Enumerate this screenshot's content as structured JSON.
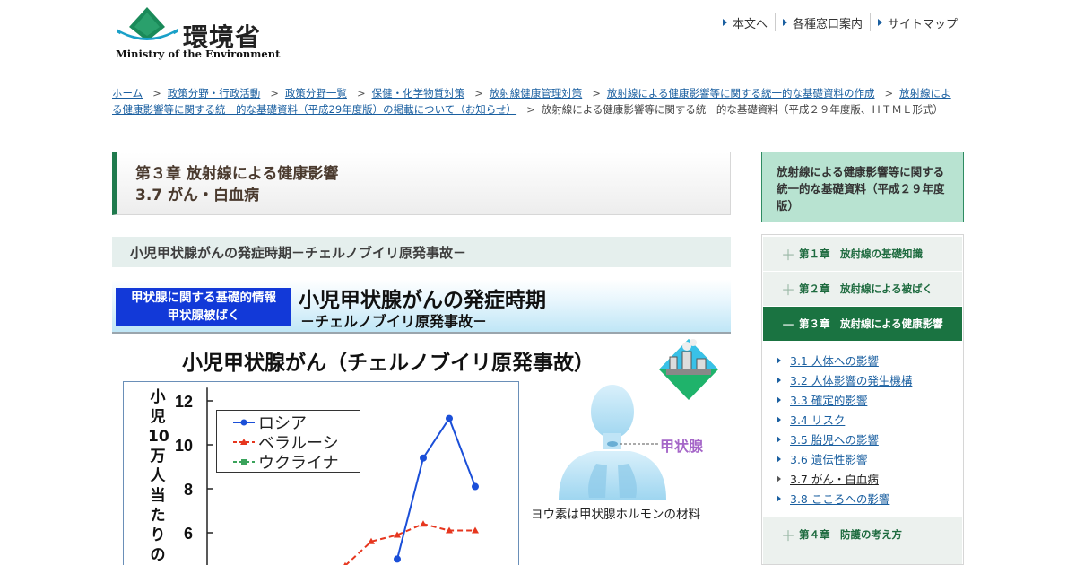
{
  "header": {
    "logo_ja": "環境省",
    "logo_en": "Ministry of the Environment",
    "nav": [
      "本文へ",
      "各種窓口案内",
      "サイトマップ"
    ]
  },
  "breadcrumb": {
    "links": [
      "ホーム",
      "政策分野・行政活動",
      "政策分野一覧",
      "保健・化学物質対策",
      "放射線健康管理対策",
      "放射線による健康影響等に関する統一的な基礎資料の作成",
      "放射線による健康影響等に関する統一的な基礎資料（平成29年度版）の掲載について（お知らせ）"
    ],
    "current": "放射線による健康影響等に関する統一的な基礎資料（平成２９年度版、ＨＴＭＬ形式）"
  },
  "main": {
    "chapter": "第３章 放射線による健康影響",
    "section": "3.7 がん・白血病",
    "subhead": "小児甲状腺がんの発症時期－チェルノブイリ原発事故－"
  },
  "slide": {
    "tag_line1": "甲状腺に関する基礎的情報",
    "tag_line2": "甲状腺被ばく",
    "title1": "小児甲状腺がんの発症時期",
    "title2": "－チェルノブイリ原発事故－",
    "figure_label": "甲状腺",
    "figure_caption": "ヨウ素は甲状腺ホルモンの材料",
    "colors": {
      "russia": "#1b4fd8",
      "belarus": "#e6361e",
      "ukraine": "#3aa35b"
    }
  },
  "chart_data": {
    "type": "line",
    "title": "小児甲状腺がん（チェルノブイリ原発事故）",
    "ylabel": "小児10万人当たりの甲",
    "yticks": [
      6,
      8,
      10,
      12
    ],
    "ylim": [
      4.8,
      12.6
    ],
    "x": [
      1,
      2,
      3,
      4,
      5,
      6,
      7,
      8,
      9,
      10,
      11,
      12
    ],
    "series": [
      {
        "name": "ロシア",
        "values": [
          null,
          null,
          null,
          null,
          null,
          null,
          null,
          null,
          4.8,
          9.4,
          11.2,
          8.1
        ]
      },
      {
        "name": "ベラルーシ",
        "values": [
          null,
          null,
          null,
          null,
          null,
          null,
          4.5,
          5.6,
          5.9,
          6.4,
          6.1,
          6.1
        ]
      },
      {
        "name": "ウクライナ",
        "values": []
      }
    ]
  },
  "sidebar": {
    "title": "放射線による健康影響等に関する統一的な基礎資料（平成２９年度版）",
    "chapters": [
      {
        "label": "第１章　放射線の基礎知識",
        "mark": "＋"
      },
      {
        "label": "第２章　放射線による被ばく",
        "mark": "＋"
      },
      {
        "label": "第３章　放射線による健康影響",
        "mark": "－"
      },
      {
        "label": "第４章　防護の考え方",
        "mark": "＋"
      }
    ],
    "subitems": [
      "3.1 人体への影響",
      "3.2 人体影響の発生機構",
      "3.3 確定的影響",
      "3.4 リスク",
      "3.5 胎児への影響",
      "3.6 遺伝性影響",
      "3.7 がん・白血病",
      "3.8 こころへの影響"
    ]
  }
}
